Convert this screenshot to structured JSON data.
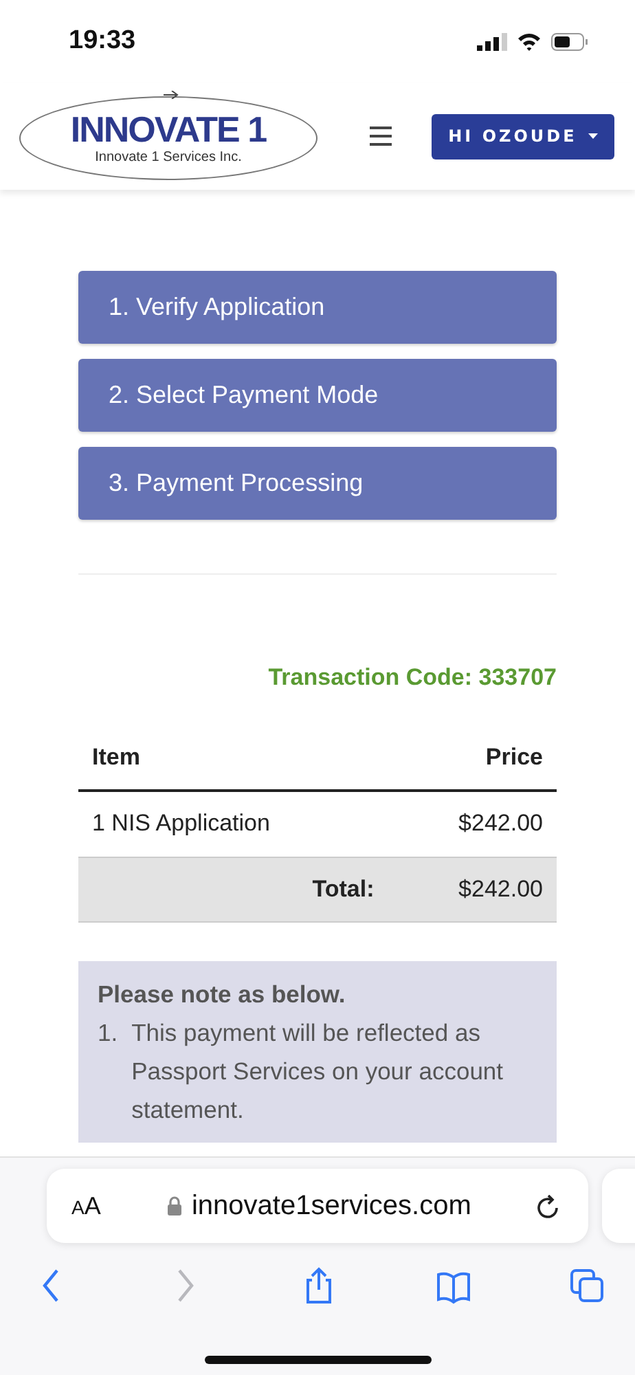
{
  "status_bar": {
    "time": "19:33"
  },
  "header": {
    "logo": {
      "title": "INNOVATE 1",
      "subtitle": "Innovate 1 Services Inc."
    },
    "user_button": "HI OZOUDE"
  },
  "steps": [
    {
      "label": "1. Verify Application"
    },
    {
      "label": "2. Select Payment Mode"
    },
    {
      "label": "3. Payment Processing"
    }
  ],
  "transaction_code": "Transaction Code: 333707",
  "table": {
    "columns": [
      "Item",
      "Price"
    ],
    "rows": [
      {
        "item": "1 NIS Application",
        "price": "$242.00"
      }
    ],
    "total": {
      "label": "Total:",
      "value": "$242.00"
    }
  },
  "note": {
    "title": "Please note as below.",
    "items": [
      {
        "number": "1.",
        "text": "This payment will be reflected as Passport Services on your account statement."
      }
    ]
  },
  "browser": {
    "text_size": "AA",
    "url": "innovate1services.com",
    "toolbar": [
      {
        "kind": "back",
        "disabled": false
      },
      {
        "kind": "forward",
        "disabled": true
      },
      {
        "kind": "share",
        "disabled": false
      },
      {
        "kind": "bookmarks",
        "disabled": false
      },
      {
        "kind": "tabs",
        "disabled": false
      }
    ]
  }
}
